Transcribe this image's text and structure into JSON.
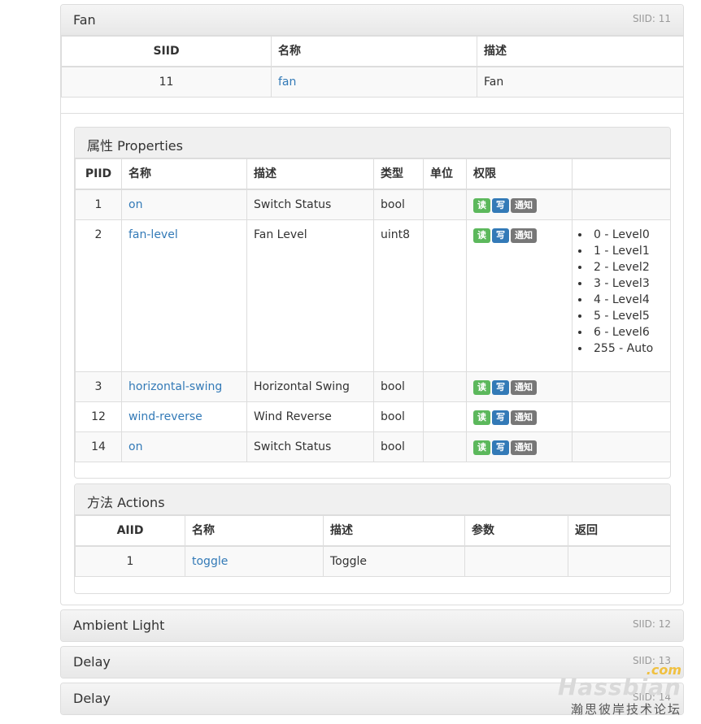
{
  "service": {
    "title": "Fan",
    "siid_label": "SIID: 11",
    "table": {
      "headers": [
        "SIID",
        "名称",
        "描述"
      ],
      "row": {
        "siid": "11",
        "name": "fan",
        "desc": "Fan"
      }
    }
  },
  "properties": {
    "title": "属性 Properties",
    "headers": [
      "PIID",
      "名称",
      "描述",
      "类型",
      "单位",
      "权限",
      ""
    ],
    "rows": [
      {
        "piid": "1",
        "name": "on",
        "desc": "Switch Status",
        "type": "bool",
        "unit": ""
      },
      {
        "piid": "2",
        "name": "fan-level",
        "desc": "Fan Level",
        "type": "uint8",
        "unit": "",
        "values": [
          "0 - Level0",
          "1 - Level1",
          "2 - Level2",
          "3 - Level3",
          "4 - Level4",
          "5 - Level5",
          "6 - Level6",
          "255 - Auto"
        ]
      },
      {
        "piid": "3",
        "name": "horizontal-swing",
        "desc": "Horizontal Swing",
        "type": "bool",
        "unit": ""
      },
      {
        "piid": "12",
        "name": "wind-reverse",
        "desc": "Wind Reverse",
        "type": "bool",
        "unit": ""
      },
      {
        "piid": "14",
        "name": "on",
        "desc": "Switch Status",
        "type": "bool",
        "unit": ""
      }
    ],
    "access_labels": {
      "read": "读",
      "write": "写",
      "notify": "通知"
    }
  },
  "actions": {
    "title": "方法 Actions",
    "headers": [
      "AIID",
      "名称",
      "描述",
      "参数",
      "返回"
    ],
    "rows": [
      {
        "aiid": "1",
        "name": "toggle",
        "desc": "Toggle",
        "params": "",
        "returns": ""
      }
    ]
  },
  "other_services": [
    {
      "title": "Ambient Light",
      "siid_label": "SIID: 12"
    },
    {
      "title": "Delay",
      "siid_label": "SIID: 13"
    },
    {
      "title": "Delay",
      "siid_label": "SIID: 14"
    }
  ],
  "watermark": {
    "brand": "Hassbian",
    "tld": ".com",
    "tagline": "瀚思彼岸技术论坛"
  },
  "colors": {
    "link": "#337ab7",
    "read": "#5cb85c",
    "write": "#337ab7",
    "notify": "#777777"
  }
}
